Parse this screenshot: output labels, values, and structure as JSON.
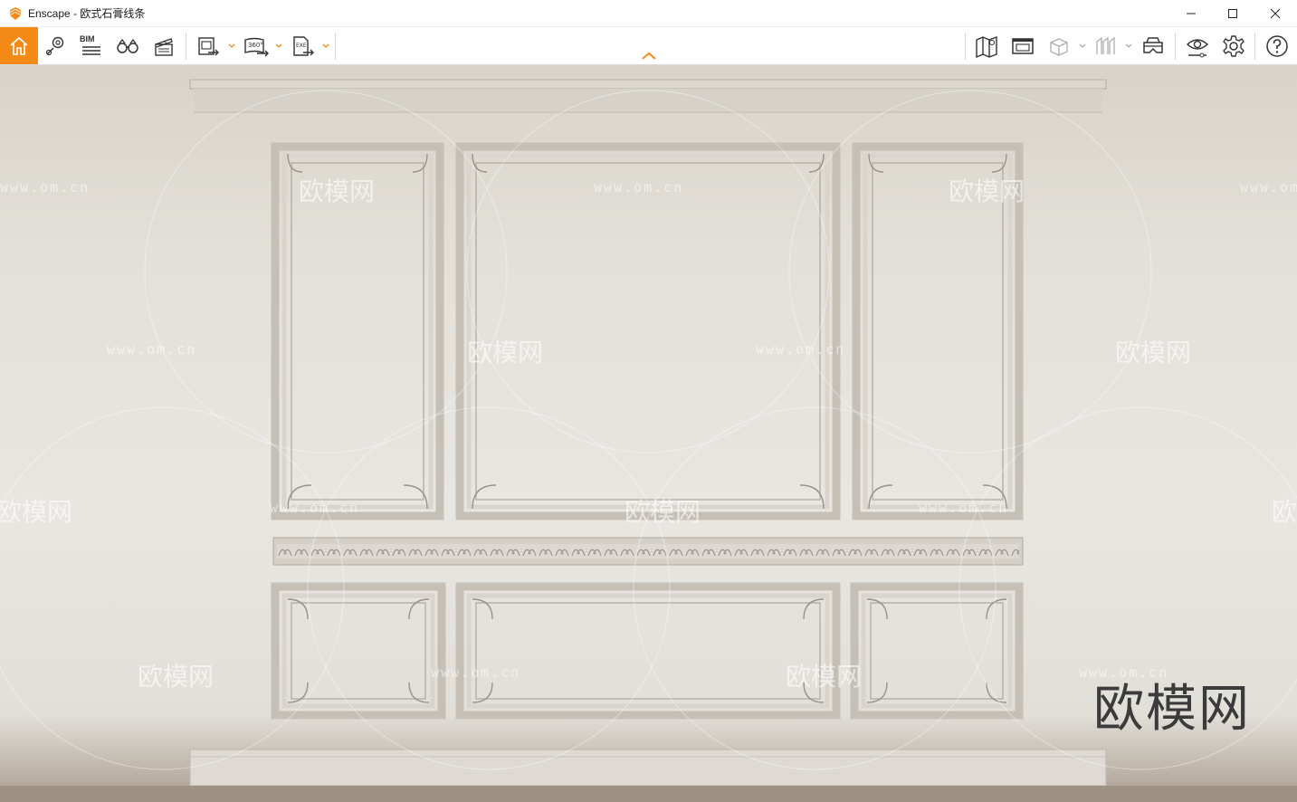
{
  "window": {
    "title": "Enscape - 欧式石膏线条",
    "controls": [
      "minimize",
      "maximize",
      "close"
    ]
  },
  "toolbar": {
    "bim_label": "BIM",
    "icons_left": [
      "home-icon",
      "location-pin-icon",
      "bim-list-icon",
      "binoculars-icon",
      "clapperboard-icon",
      "screenshot-export-icon",
      "panorama-360-export-icon",
      "exe-export-icon"
    ],
    "icons_right": [
      "map-icon",
      "render-window-icon",
      "box-view-icon",
      "sections-icon",
      "vr-headset-icon",
      "visibility-settings-icon",
      "settings-icon",
      "help-icon"
    ],
    "accent": "#f38a17"
  },
  "watermark": {
    "url": "www.om.cn",
    "logo": "欧模网",
    "big": "欧模网"
  }
}
